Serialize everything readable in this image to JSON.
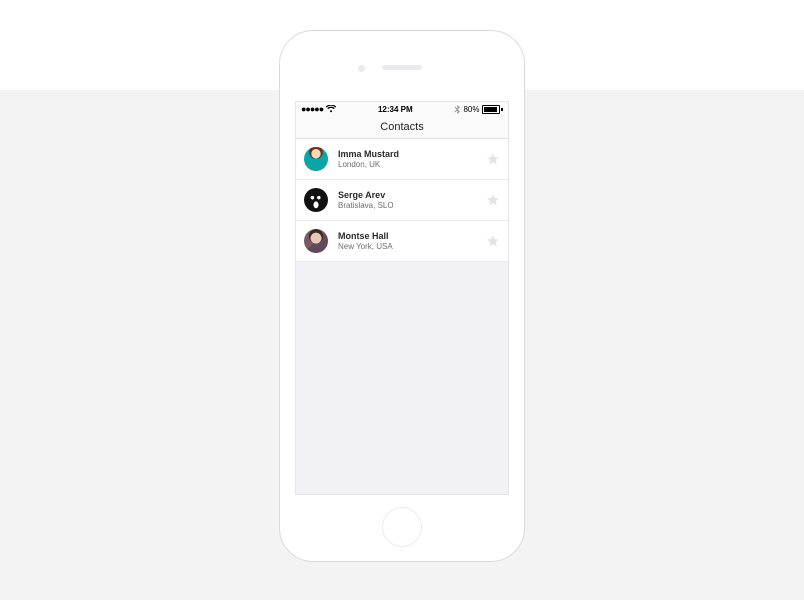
{
  "status": {
    "signal_dots": "●●●●●",
    "time": "12:34 PM",
    "battery_pct": "80%"
  },
  "nav": {
    "title": "Contacts"
  },
  "contacts": [
    {
      "name": "Imma Mustard",
      "location": "London, UK",
      "favorite": false
    },
    {
      "name": "Serge Arev",
      "location": "Bratislava, SLO",
      "favorite": false
    },
    {
      "name": "Montse Hall",
      "location": "New York, USA",
      "favorite": false
    }
  ]
}
